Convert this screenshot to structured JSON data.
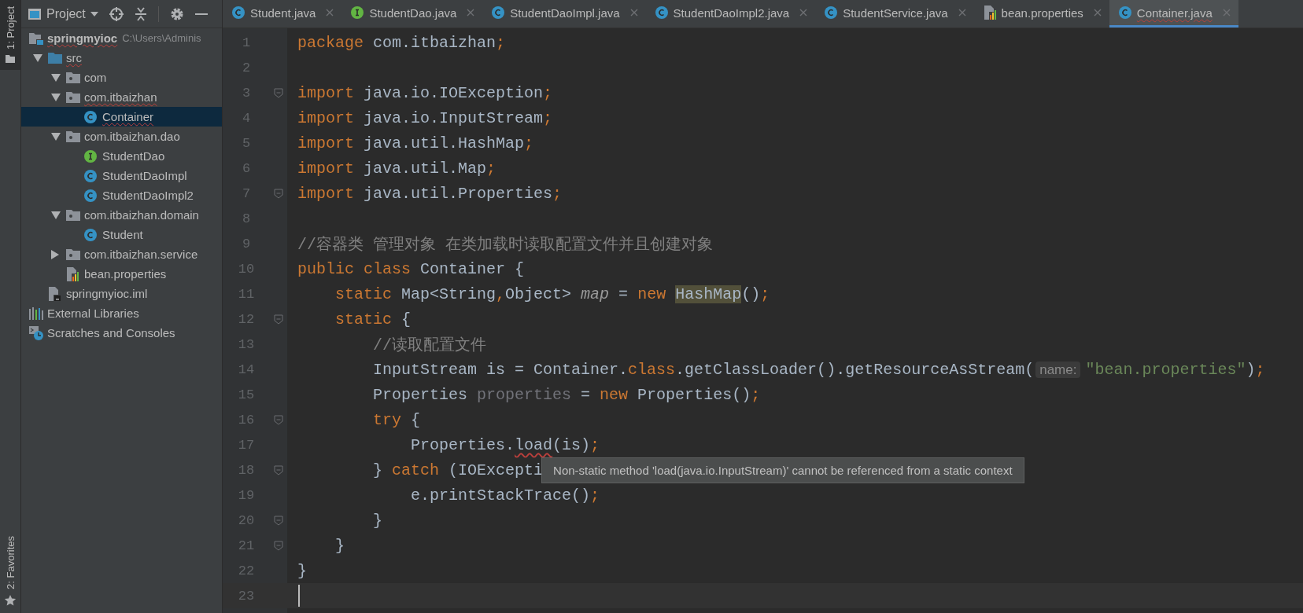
{
  "tool_strip": {
    "top": {
      "label": "1: Project",
      "selected": true
    },
    "bottom": {
      "label": "2: Favorites",
      "selected": false
    }
  },
  "project_panel": {
    "title": "Project",
    "tree": [
      {
        "label": "springmyioc",
        "path": "C:\\Users\\Adminis",
        "kind": "project",
        "error": true,
        "selected": false,
        "children": [
          {
            "label": "src",
            "kind": "source-folder",
            "expanded": true,
            "error": true,
            "selected": false,
            "children": [
              {
                "label": "com",
                "kind": "package",
                "expanded": true,
                "error": false,
                "selected": false
              },
              {
                "label": "com.itbaizhan",
                "kind": "package",
                "expanded": true,
                "error": true,
                "selected": false,
                "children": [
                  {
                    "label": "Container",
                    "kind": "class",
                    "error": true,
                    "selected": true
                  }
                ]
              },
              {
                "label": "com.itbaizhan.dao",
                "kind": "package",
                "expanded": true,
                "error": false,
                "selected": false,
                "children": [
                  {
                    "label": "StudentDao",
                    "kind": "interface",
                    "error": false,
                    "selected": false
                  },
                  {
                    "label": "StudentDaoImpl",
                    "kind": "class",
                    "error": false,
                    "selected": false
                  },
                  {
                    "label": "StudentDaoImpl2",
                    "kind": "class",
                    "error": false,
                    "selected": false
                  }
                ]
              },
              {
                "label": "com.itbaizhan.domain",
                "kind": "package",
                "expanded": true,
                "error": false,
                "selected": false,
                "children": [
                  {
                    "label": "Student",
                    "kind": "class",
                    "error": false,
                    "selected": false
                  }
                ]
              },
              {
                "label": "com.itbaizhan.service",
                "kind": "package",
                "expanded": false,
                "error": false,
                "selected": false
              },
              {
                "label": "bean.properties",
                "kind": "properties",
                "error": false,
                "selected": false
              }
            ]
          },
          {
            "label": "springmyioc.iml",
            "kind": "module-file",
            "error": false,
            "selected": false
          }
        ]
      },
      {
        "label": "External Libraries",
        "kind": "libraries",
        "error": false,
        "selected": false
      },
      {
        "label": "Scratches and Consoles",
        "kind": "scratches",
        "error": false,
        "selected": false
      }
    ]
  },
  "tabs": [
    {
      "label": "Student.java",
      "kind": "class",
      "selected": false,
      "error": false
    },
    {
      "label": "StudentDao.java",
      "kind": "interface",
      "selected": false,
      "error": false
    },
    {
      "label": "StudentDaoImpl.java",
      "kind": "class",
      "selected": false,
      "error": false
    },
    {
      "label": "StudentDaoImpl2.java",
      "kind": "class",
      "selected": false,
      "error": false
    },
    {
      "label": "StudentService.java",
      "kind": "class",
      "selected": false,
      "error": false
    },
    {
      "label": "bean.properties",
      "kind": "properties",
      "selected": false,
      "error": false
    },
    {
      "label": "Container.java",
      "kind": "class",
      "selected": true,
      "error": true
    }
  ],
  "editor": {
    "lines": [
      {
        "number": "1",
        "tokens": [
          {
            "text": "package",
            "kind": "keyword"
          },
          {
            "text": " com.itbaizhan",
            "kind": "plain"
          },
          {
            "text": ";",
            "kind": "keyword"
          }
        ]
      },
      {
        "number": "2"
      },
      {
        "number": "3",
        "fold": true,
        "tokens": [
          {
            "text": "import",
            "kind": "keyword"
          },
          {
            "text": " java.io.IOException",
            "kind": "plain"
          },
          {
            "text": ";",
            "kind": "keyword"
          }
        ]
      },
      {
        "number": "4",
        "tokens": [
          {
            "text": "import",
            "kind": "keyword"
          },
          {
            "text": " java.io.InputStream",
            "kind": "plain"
          },
          {
            "text": ";",
            "kind": "keyword"
          }
        ]
      },
      {
        "number": "5",
        "tokens": [
          {
            "text": "import",
            "kind": "keyword"
          },
          {
            "text": " java.util.HashMap",
            "kind": "plain"
          },
          {
            "text": ";",
            "kind": "keyword"
          }
        ]
      },
      {
        "number": "6",
        "tokens": [
          {
            "text": "import",
            "kind": "keyword"
          },
          {
            "text": " java.util.Map",
            "kind": "plain"
          },
          {
            "text": ";",
            "kind": "keyword"
          }
        ]
      },
      {
        "number": "7",
        "fold": true,
        "tokens": [
          {
            "text": "import",
            "kind": "keyword"
          },
          {
            "text": " java.util.Properties",
            "kind": "plain"
          },
          {
            "text": ";",
            "kind": "keyword"
          }
        ]
      },
      {
        "number": "8"
      },
      {
        "number": "9",
        "tokens": [
          {
            "text": "//容器类 管理对象 在类加载时读取配置文件并且创建对象",
            "kind": "comment"
          }
        ]
      },
      {
        "number": "10",
        "tokens": [
          {
            "text": "public class",
            "kind": "keyword"
          },
          {
            "text": " Container {",
            "kind": "plain"
          }
        ]
      },
      {
        "number": "11",
        "tokens": [
          {
            "text": "    static",
            "kind": "keyword"
          },
          {
            "text": " Map<String",
            "kind": "plain"
          },
          {
            "text": ",",
            "kind": "keyword"
          },
          {
            "text": "Object> ",
            "kind": "plain"
          },
          {
            "text": "map",
            "kind": "field"
          },
          {
            "text": " = ",
            "kind": "plain"
          },
          {
            "text": "new ",
            "kind": "keyword"
          },
          {
            "text": "HashMap",
            "kind": "highlight"
          },
          {
            "text": "()",
            "kind": "plain"
          },
          {
            "text": ";",
            "kind": "keyword"
          }
        ]
      },
      {
        "number": "12",
        "fold": true,
        "tokens": [
          {
            "text": "    static",
            "kind": "keyword"
          },
          {
            "text": " {",
            "kind": "plain"
          }
        ]
      },
      {
        "number": "13",
        "tokens": [
          {
            "text": "        //读取配置文件",
            "kind": "comment"
          }
        ]
      },
      {
        "number": "14",
        "tokens": [
          {
            "text": "        InputStream is = Container.",
            "kind": "plain"
          },
          {
            "text": "class",
            "kind": "keyword"
          },
          {
            "text": ".getClassLoader().getResourceAsStream(",
            "kind": "plain"
          },
          {
            "text": "name:",
            "kind": "hint"
          },
          {
            "text": "\"bean.properties\"",
            "kind": "string"
          },
          {
            "text": ")",
            "kind": "plain"
          },
          {
            "text": ";",
            "kind": "keyword"
          }
        ]
      },
      {
        "number": "15",
        "tokens": [
          {
            "text": "        Properties ",
            "kind": "plain"
          },
          {
            "text": "properties",
            "kind": "unused"
          },
          {
            "text": " = ",
            "kind": "plain"
          },
          {
            "text": "new",
            "kind": "keyword"
          },
          {
            "text": " Properties()",
            "kind": "plain"
          },
          {
            "text": ";",
            "kind": "keyword"
          }
        ]
      },
      {
        "number": "16",
        "fold": true,
        "tokens": [
          {
            "text": "        try",
            "kind": "keyword"
          },
          {
            "text": " {",
            "kind": "plain"
          }
        ]
      },
      {
        "number": "17",
        "tokens": [
          {
            "text": "            Properties.",
            "kind": "plain"
          },
          {
            "text": "load",
            "kind": "error"
          },
          {
            "text": "(is)",
            "kind": "plain"
          },
          {
            "text": ";",
            "kind": "keyword"
          }
        ]
      },
      {
        "number": "18",
        "fold": true,
        "tooltip": "Non-static method 'load(java.io.InputStream)' cannot be referenced from a static context",
        "tokens": [
          {
            "text": "        } ",
            "kind": "plain"
          },
          {
            "text": "catch",
            "kind": "keyword"
          },
          {
            "text": " (IOExcepti",
            "kind": "plain"
          }
        ]
      },
      {
        "number": "19",
        "tokens": [
          {
            "text": "            e.printStackTrace()",
            "kind": "plain"
          },
          {
            "text": ";",
            "kind": "keyword"
          }
        ]
      },
      {
        "number": "20",
        "fold": true,
        "tokens": [
          {
            "text": "        }",
            "kind": "plain"
          }
        ]
      },
      {
        "number": "21",
        "fold": true,
        "tokens": [
          {
            "text": "    }",
            "kind": "plain"
          }
        ]
      },
      {
        "number": "22",
        "tokens": [
          {
            "text": "}",
            "kind": "plain"
          }
        ]
      },
      {
        "number": "23",
        "current": true
      }
    ]
  }
}
